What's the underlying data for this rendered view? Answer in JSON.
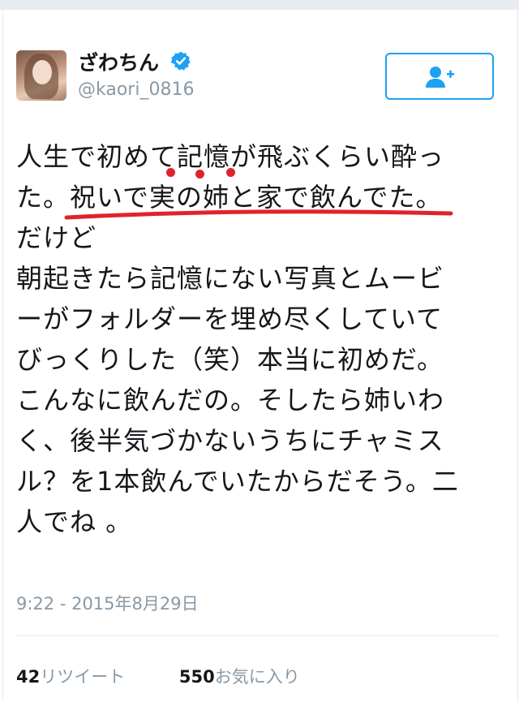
{
  "user": {
    "display_name": "ざわちん",
    "handle": "@kaori_0816",
    "verified": true
  },
  "icons": {
    "verified": "verified-badge-icon",
    "follow": "add-user-icon"
  },
  "tweet": {
    "text": "人生で初めて記憶が飛ぶくらい酔っ\nた。祝いで実の姉と家で飲んでた。\nだけど\n朝起きたら記憶にない写真とムービ\nーがフォルダーを埋め尽くしていて\nびっくりした（笑）本当に初めだ。\nこんなに飲んだの。そしたら姉いわ\nく、後半気づかないうちにチャミス\nル？を1本飲んでいたからだそう。二\n人でね 。",
    "timestamp": "9:22 - 2015年8月29日"
  },
  "stats": {
    "retweets_count": "42",
    "retweets_label": "リツイート",
    "likes_count": "550",
    "likes_label": "お気に入り"
  },
  "colors": {
    "accent": "#1da1f2",
    "annotation": "#e0232b",
    "muted": "#8899a6"
  }
}
